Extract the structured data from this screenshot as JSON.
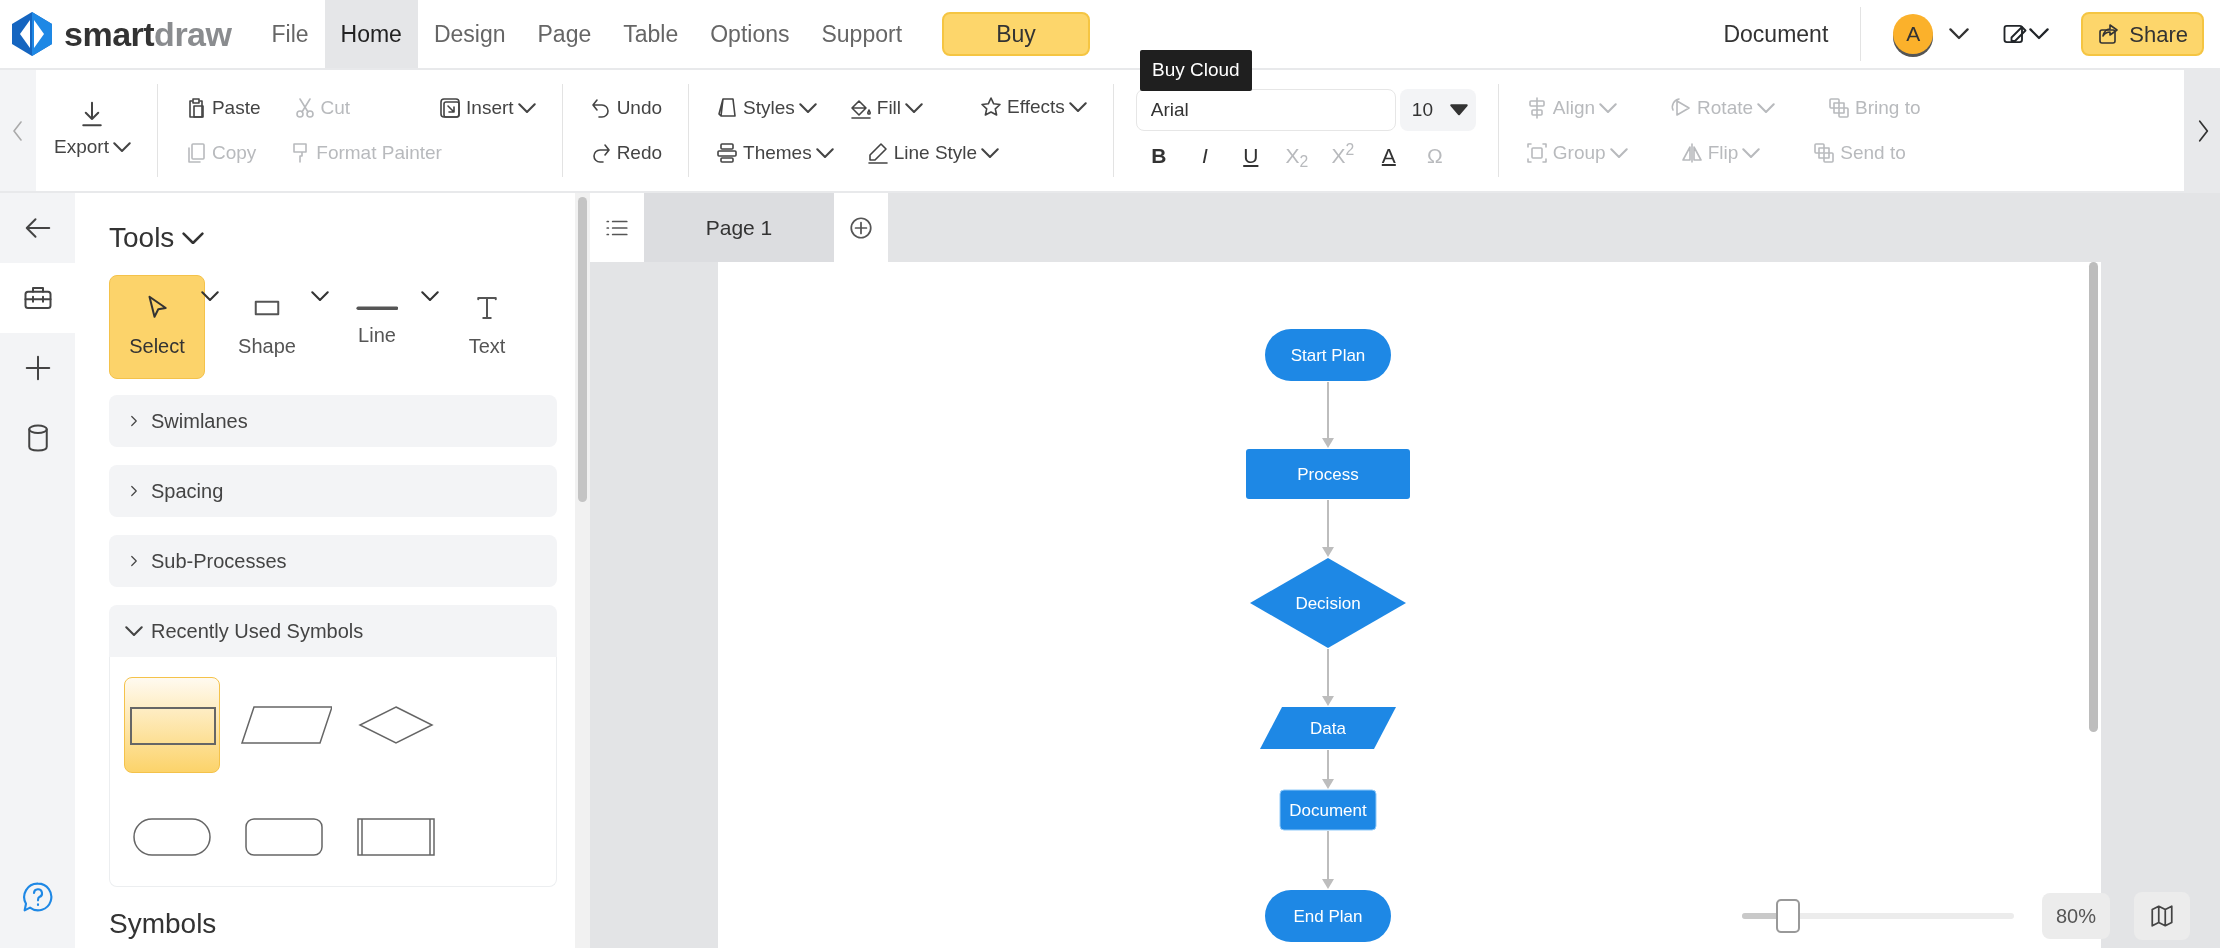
{
  "logo": {
    "part1": "smart",
    "part2": "draw"
  },
  "menu": [
    {
      "label": "File",
      "selected": false
    },
    {
      "label": "Home",
      "selected": true
    },
    {
      "label": "Design",
      "selected": false
    },
    {
      "label": "Page",
      "selected": false
    },
    {
      "label": "Table",
      "selected": false
    },
    {
      "label": "Options",
      "selected": false
    },
    {
      "label": "Support",
      "selected": false
    }
  ],
  "buy_button": "Buy",
  "tooltip": "Buy Cloud",
  "document_label": "Document",
  "avatar": "A",
  "share_button": "Share",
  "toolbar": {
    "groups": [
      {
        "rows": [
          [
            {
              "label": "Export",
              "disabled": false,
              "dropdown": true
            }
          ]
        ]
      },
      {
        "rows": [
          [
            {
              "label": "Paste",
              "disabled": false,
              "dropdown": false
            },
            {
              "label": "Cut",
              "disabled": true,
              "dropdown": false
            },
            {
              "label": "Insert",
              "disabled": false,
              "dropdown": true
            }
          ],
          [
            {
              "label": "Copy",
              "disabled": true,
              "dropdown": false
            },
            {
              "label": "Format Painter",
              "disabled": true,
              "dropdown": false
            }
          ]
        ]
      },
      {
        "rows": [
          [
            {
              "label": "Undo",
              "disabled": false,
              "dropdown": false
            }
          ],
          [
            {
              "label": "Redo",
              "disabled": false,
              "dropdown": false
            }
          ]
        ]
      },
      {
        "rows": [
          [
            {
              "label": "Styles",
              "disabled": false,
              "dropdown": true
            },
            {
              "label": "Fill",
              "disabled": false,
              "dropdown": true
            },
            {
              "label": "Effects",
              "disabled": false,
              "dropdown": true
            }
          ],
          [
            {
              "label": "Themes",
              "disabled": false,
              "dropdown": true
            },
            {
              "label": "Line Style",
              "disabled": false,
              "dropdown": true
            }
          ]
        ]
      },
      {
        "font_field": {
          "value": "Arial"
        },
        "size_field": {
          "value": "10"
        },
        "format_buttons": [
          {
            "label": "B",
            "disabled": false
          },
          {
            "label": "I",
            "disabled": false
          },
          {
            "label": "U",
            "disabled": false
          },
          {
            "label": "X$_{2}$",
            "disabled": true
          },
          {
            "label": "X$^{2}$",
            "disabled": true
          },
          {
            "label": "A",
            "disabled": false
          },
          {
            "label": "Ω",
            "disabled": true
          }
        ]
      },
      {
        "rows": [
          [
            {
              "label": "Align",
              "disabled": true,
              "dropdown": true
            },
            {
              "label": "Rotate",
              "disabled": true,
              "dropdown": true
            },
            {
              "label": "Bring to",
              "disabled": true,
              "dropdown": false
            }
          ],
          [
            {
              "label": "Group",
              "disabled": true,
              "dropdown": true
            },
            {
              "label": "Flip",
              "disabled": true,
              "dropdown": true
            },
            {
              "label": "Send to",
              "disabled": true,
              "dropdown": false
            }
          ]
        ]
      }
    ]
  },
  "rail": [
    {
      "selected": false
    },
    {
      "selected": true
    },
    {
      "selected": false
    },
    {
      "selected": false
    }
  ],
  "panel": {
    "title": "Tools",
    "tools": [
      {
        "label": "Select",
        "selected": true,
        "dropdown": true
      },
      {
        "label": "Shape",
        "selected": false,
        "dropdown": true
      },
      {
        "label": "Line",
        "selected": false,
        "dropdown": true
      },
      {
        "label": "Text",
        "selected": false,
        "dropdown": false
      }
    ],
    "sections": [
      {
        "label": "Swimlanes",
        "expanded": false
      },
      {
        "label": "Spacing",
        "expanded": false
      },
      {
        "label": "Sub-Processes",
        "expanded": false
      },
      {
        "label": "Recently Used Symbols",
        "expanded": true
      }
    ],
    "recent_symbols": [
      {
        "selected": true
      },
      {
        "selected": false
      },
      {
        "selected": false
      },
      {
        "selected": false
      },
      {
        "selected": false
      },
      {
        "selected": false
      }
    ],
    "symbols_heading": "Symbols"
  },
  "page_tabs": [
    {
      "label": "Page 1",
      "selected": true
    }
  ],
  "flowchart": {
    "nodes": [
      {
        "kind": "terminal",
        "label": "Start Plan"
      },
      {
        "kind": "process",
        "label": "Process"
      },
      {
        "kind": "decision",
        "label": "Decision"
      },
      {
        "kind": "data",
        "label": "Data"
      },
      {
        "kind": "document",
        "label": "Document"
      },
      {
        "kind": "terminal",
        "label": "End Plan"
      }
    ]
  },
  "zoom": {
    "level": 0.17,
    "reading": "80%"
  }
}
